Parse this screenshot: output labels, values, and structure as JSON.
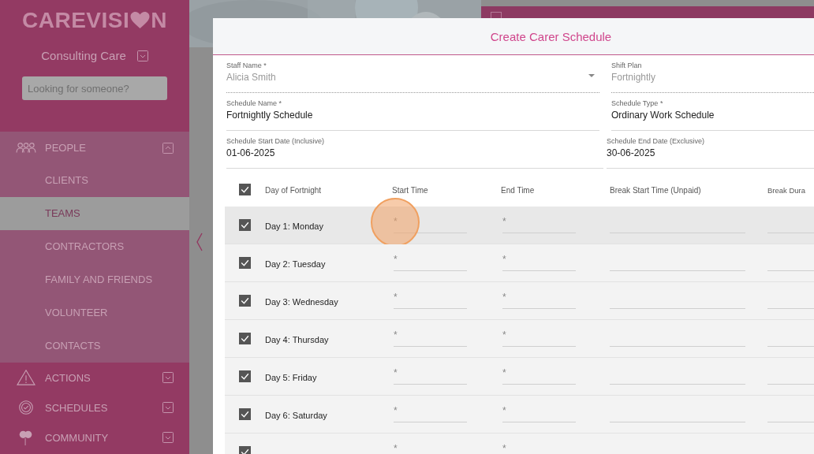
{
  "sidebar": {
    "logo": {
      "before": "CAREVISI",
      "after": "N"
    },
    "organisation": "Consulting Care",
    "search": {
      "placeholder": "Looking for someone?"
    },
    "sections": [
      {
        "label": "PEOPLE",
        "expanded": true,
        "items": [
          {
            "label": "CLIENTS",
            "selected": false
          },
          {
            "label": "TEAMS",
            "selected": true
          },
          {
            "label": "CONTRACTORS",
            "selected": false
          },
          {
            "label": "FAMILY AND FRIENDS",
            "selected": false
          },
          {
            "label": "VOLUNTEER",
            "selected": false
          },
          {
            "label": "CONTACTS",
            "selected": false
          }
        ]
      },
      {
        "label": "ACTIONS",
        "expanded": false
      },
      {
        "label": "SCHEDULES",
        "expanded": false
      },
      {
        "label": "COMMUNITY",
        "expanded": false
      }
    ]
  },
  "dialog": {
    "title": "Create Carer Schedule",
    "fields": [
      {
        "label": "Staff Name *",
        "value": "Alicia Smith",
        "disabled": true,
        "dropdown": true
      },
      {
        "label": "Shift Plan",
        "value": "Fortnightly",
        "disabled": true,
        "dropdown": false
      },
      {
        "label": "Schedule Name *",
        "value": "Fortnightly Schedule",
        "disabled": false,
        "dropdown": false
      },
      {
        "label": "Schedule Type *",
        "value": "Ordinary Work Schedule",
        "disabled": false,
        "dropdown": false
      },
      {
        "label": "Schedule Start Date (Inclusive)",
        "value": "01-06-2025",
        "disabled": false,
        "dropdown": false
      },
      {
        "label": "Schedule End Date (Exclusive)",
        "value": "30-06-2025",
        "disabled": false,
        "dropdown": false
      }
    ],
    "table": {
      "all_checked": true,
      "columns": [
        "Day of Fortnight",
        "Start Time",
        "End Time",
        "Break Start Time (Unpaid)",
        "Break Dura"
      ],
      "rows": [
        {
          "day": "Day 1: Monday",
          "checked": true,
          "highlighted": true,
          "start_placeholder": "*",
          "end_placeholder": "*"
        },
        {
          "day": "Day 2: Tuesday",
          "checked": true,
          "highlighted": false,
          "start_placeholder": "*",
          "end_placeholder": "*"
        },
        {
          "day": "Day 3: Wednesday",
          "checked": true,
          "highlighted": false,
          "start_placeholder": "*",
          "end_placeholder": "*"
        },
        {
          "day": "Day 4: Thursday",
          "checked": true,
          "highlighted": false,
          "start_placeholder": "*",
          "end_placeholder": "*"
        },
        {
          "day": "Day 5: Friday",
          "checked": true,
          "highlighted": false,
          "start_placeholder": "*",
          "end_placeholder": "*"
        },
        {
          "day": "Day 6: Saturday",
          "checked": true,
          "highlighted": false,
          "start_placeholder": "*",
          "end_placeholder": "*"
        },
        {
          "checked": true,
          "highlighted": false,
          "start_placeholder": "*",
          "end_placeholder": "*"
        }
      ]
    }
  }
}
